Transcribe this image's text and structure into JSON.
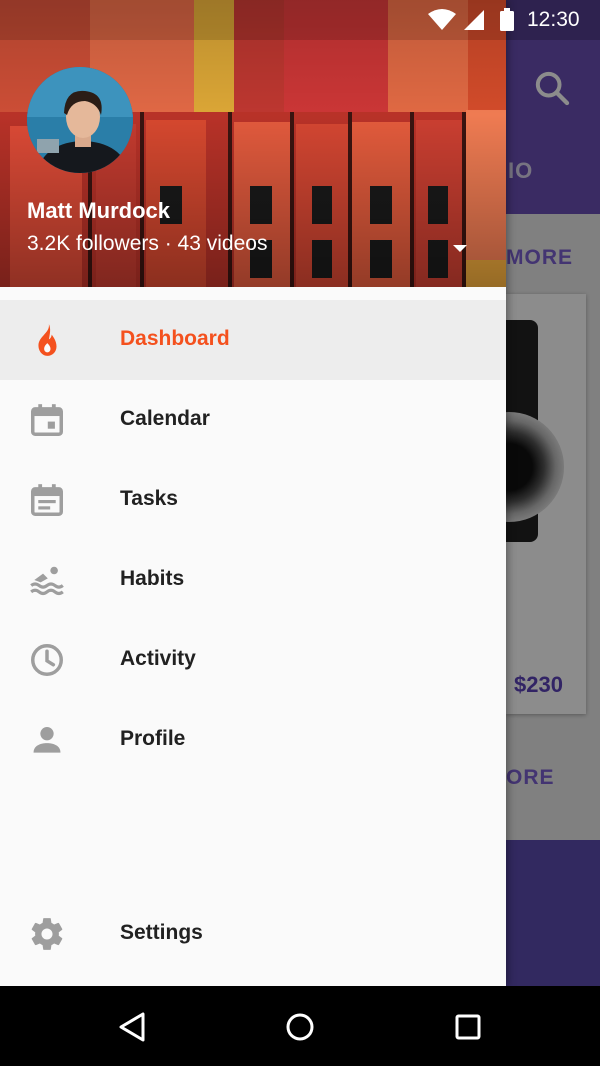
{
  "status_bar": {
    "time": "12:30",
    "icons": [
      "wifi-icon",
      "signal-icon",
      "battery-icon"
    ]
  },
  "background_app": {
    "tab_label": "IO",
    "more_label_top": "MORE",
    "more_label_bottom": "ORE",
    "price": "$230"
  },
  "drawer": {
    "user": {
      "name": "Matt Murdock",
      "meta": "3.2K followers · 43 videos"
    },
    "items": [
      {
        "label": "Dashboard",
        "icon": "flame-icon",
        "active": true
      },
      {
        "label": "Calendar",
        "icon": "calendar-icon"
      },
      {
        "label": "Tasks",
        "icon": "tasks-icon"
      },
      {
        "label": "Habits",
        "icon": "swim-icon"
      },
      {
        "label": "Activity",
        "icon": "clock-icon"
      },
      {
        "label": "Profile",
        "icon": "person-icon"
      }
    ],
    "settings": {
      "label": "Settings",
      "icon": "gear-icon"
    }
  },
  "nav_bar": [
    "back-icon",
    "home-icon",
    "recents-icon"
  ],
  "colors": {
    "accent": "#f4511e",
    "icon": "#9e9e9e",
    "toolbar": "#6a4fb5",
    "drawer_bg": "#fafafa",
    "active_row": "#ededed"
  }
}
